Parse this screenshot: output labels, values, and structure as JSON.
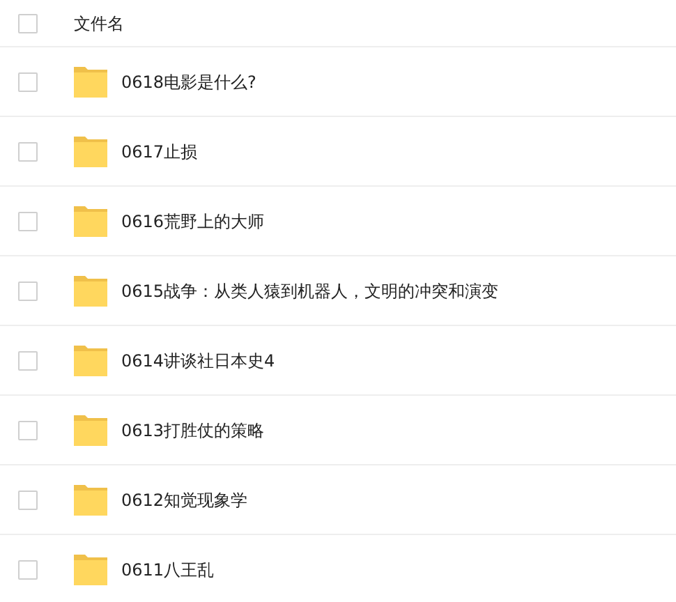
{
  "header": {
    "checked": false,
    "label": "文件名"
  },
  "files": [
    {
      "name": "0618电影是什么?",
      "checked": false
    },
    {
      "name": "0617止损",
      "checked": false
    },
    {
      "name": "0616荒野上的大师",
      "checked": false
    },
    {
      "name": "0615战争：从类人猿到机器人，文明的冲突和演变",
      "checked": false
    },
    {
      "name": "0614讲谈社日本史4",
      "checked": false
    },
    {
      "name": "0613打胜仗的策略",
      "checked": false
    },
    {
      "name": "0612知觉现象学",
      "checked": false
    },
    {
      "name": "0611八王乱",
      "checked": false
    }
  ]
}
